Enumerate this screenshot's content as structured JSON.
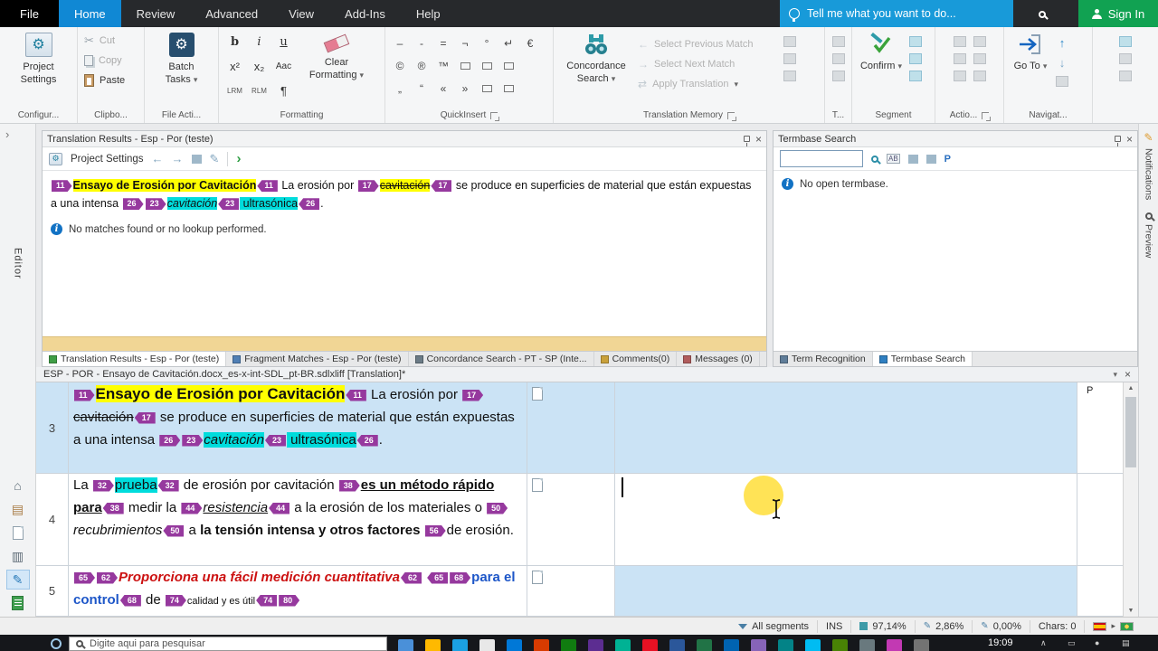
{
  "colors": {
    "hl_yellow": "#ffff00",
    "hl_cyan": "#00dcdc",
    "tag_purple": "#96399e",
    "row_active": "#cbe3f5",
    "accent_blue": "#189ad9",
    "signin_green": "#11a252",
    "red_text": "#cc1111",
    "blue_text": "#1d56c8"
  },
  "menubar": {
    "items": [
      {
        "label": "File",
        "style": "file"
      },
      {
        "label": "Home",
        "style": "active"
      },
      {
        "label": "Review",
        "style": ""
      },
      {
        "label": "Advanced",
        "style": ""
      },
      {
        "label": "View",
        "style": ""
      },
      {
        "label": "Add-Ins",
        "style": ""
      },
      {
        "label": "Help",
        "style": ""
      }
    ],
    "tellme": "Tell me what you want to do...",
    "signin": "Sign In"
  },
  "ribbon": {
    "project_settings": {
      "line1": "Project",
      "line2": "Settings",
      "group": "Configur..."
    },
    "clipboard": {
      "cut": "Cut",
      "copy": "Copy",
      "paste": "Paste",
      "group": "Clipbo..."
    },
    "file_actions": {
      "line1": "Batch",
      "line2": "Tasks",
      "group": "File Acti..."
    },
    "formatting": {
      "buttons": [
        "b",
        "i",
        "u",
        "x²",
        "x₂",
        "Aac",
        "LRM",
        "RLM",
        "¶"
      ],
      "clear_line1": "Clear",
      "clear_line2": "Formatting",
      "group": "Formatting"
    },
    "quickinsert": {
      "rows": [
        [
          "–",
          "‐",
          "=",
          "¬",
          "°",
          "↵",
          "€"
        ],
        [
          "©",
          "®",
          "™",
          "▭",
          "▭",
          "▭"
        ],
        [
          "„",
          "“",
          "«",
          "»",
          "▭",
          "▭"
        ]
      ],
      "group": "QuickInsert"
    },
    "tm": {
      "concordance_line1": "Concordance",
      "concordance_line2": "Search",
      "prev": "Select Previous Match",
      "next": "Select Next Match",
      "apply": "Apply Translation",
      "group": "Translation Memory"
    },
    "t_group": "T...",
    "segment": {
      "confirm": "Confirm",
      "group": "Segment"
    },
    "actions_group": "Actio...",
    "navigation": {
      "line1": "Go",
      "line2": "To",
      "group": "Navigat..."
    }
  },
  "results_panel": {
    "title": "Translation Results - Esp - Por (teste)",
    "project_settings_label": "Project Settings",
    "message": "No matches found or no lookup performed.",
    "runs": [
      {
        "tag": "11",
        "dir": "open"
      },
      {
        "text": "Ensayo de Erosión por Cavitación",
        "hl": "yellow",
        "bold": true
      },
      {
        "tag": "11",
        "dir": "close"
      },
      {
        "text": " La erosión por "
      },
      {
        "tag": "17",
        "dir": "open"
      },
      {
        "text": "cavitación",
        "hl": "yellow",
        "strike": true
      },
      {
        "tag": "17",
        "dir": "close"
      },
      {
        "text": " se produce en superficies de material que están expuestas a una intensa "
      },
      {
        "tag": "26",
        "dir": "open"
      },
      {
        "tag": "23",
        "dir": "open"
      },
      {
        "text": "cavitación",
        "hl": "cyan",
        "italic": true
      },
      {
        "tag": "23",
        "dir": "close"
      },
      {
        "text": " ultrasónica",
        "hl": "cyan"
      },
      {
        "tag": "26",
        "dir": "close"
      },
      {
        "text": "."
      }
    ],
    "tabs": [
      {
        "label": "Translation Results - Esp - Por (teste)",
        "active": true,
        "icon": "#3f9e46"
      },
      {
        "label": "Fragment Matches - Esp - Por (teste)",
        "active": false,
        "icon": "#4f7fb5"
      },
      {
        "label": "Concordance Search - PT - SP (Inte...",
        "active": false,
        "icon": "#6b7b86"
      },
      {
        "label": "Comments(0)",
        "active": false,
        "icon": "#c9a13b"
      },
      {
        "label": "Messages (0)",
        "active": false,
        "icon": "#b05c5c"
      }
    ]
  },
  "termbase_panel": {
    "title": "Termbase Search",
    "search_value": "",
    "message": "No open termbase.",
    "tabs": [
      {
        "label": "Term Recognition",
        "active": false,
        "icon": "#5f7d99"
      },
      {
        "label": "Termbase Search",
        "active": true,
        "icon": "#2f7fc1"
      }
    ]
  },
  "left_rail": {
    "view_label": "Editor"
  },
  "right_rail": {
    "tabs": [
      "Notifications",
      "Preview"
    ]
  },
  "editor": {
    "doc_tab": "ESP - POR - Ensayo de Cavitación.docx_es-x-int-SDL_pt-BR.sdlxliff [Translation]*",
    "segments": [
      {
        "number": "3",
        "state": "selected",
        "structure": "P",
        "source_runs": [
          {
            "tag": "11",
            "dir": "open"
          },
          {
            "text": "Ensayo de Erosión por Cavitación",
            "hl": "yellow",
            "bold": true,
            "size": "large"
          },
          {
            "tag": "11",
            "dir": "close"
          },
          {
            "text": " La erosión por "
          },
          {
            "tag": "17",
            "dir": "open"
          },
          {
            "text": "cavitación",
            "strike": true
          },
          {
            "tag": "17",
            "dir": "close"
          },
          {
            "text": " se produce en superficies de material que están expuestas a una intensa "
          },
          {
            "tag": "26",
            "dir": "open"
          },
          {
            "tag": "23",
            "dir": "open"
          },
          {
            "text": "cavitación",
            "hl": "cyan",
            "italic": true
          },
          {
            "tag": "23",
            "dir": "close"
          },
          {
            "text": " ultrasónica",
            "hl": "cyan"
          },
          {
            "tag": "26",
            "dir": "close"
          },
          {
            "text": "."
          }
        ]
      },
      {
        "number": "4",
        "state": "editing",
        "structure": "",
        "source_runs": [
          {
            "text": "La "
          },
          {
            "tag": "32",
            "dir": "open"
          },
          {
            "text": "prueba",
            "hl": "cyan"
          },
          {
            "tag": "32",
            "dir": "close"
          },
          {
            "text": " de erosión por cavitación "
          },
          {
            "tag": "38",
            "dir": "open"
          },
          {
            "text": "es un método rápido para",
            "bold": true,
            "underline": true
          },
          {
            "tag": "38",
            "dir": "close"
          },
          {
            "text": " medir la "
          },
          {
            "tag": "44",
            "dir": "open"
          },
          {
            "text": "resistencia",
            "italic": true,
            "underline": true
          },
          {
            "tag": "44",
            "dir": "close"
          },
          {
            "text": " a la erosión de los materiales o "
          },
          {
            "tag": "50",
            "dir": "open"
          },
          {
            "text": "recubrimientos",
            "italic": true
          },
          {
            "tag": "50",
            "dir": "close"
          },
          {
            "text": " a "
          },
          {
            "text": "la tensión intensa y otros factores ",
            "bold": true
          },
          {
            "tag": "56",
            "dir": "open"
          },
          {
            "text": "de erosión."
          }
        ]
      },
      {
        "number": "5",
        "state": "partial",
        "structure": "",
        "source_runs": [
          {
            "tag": "65",
            "dir": "open"
          },
          {
            "tag": "62",
            "dir": "open"
          },
          {
            "text": "Proporciona una fácil medición cuantitativa",
            "italic": true,
            "bold": true,
            "color": "red"
          },
          {
            "tag": "62",
            "dir": "close"
          },
          {
            "text": " "
          },
          {
            "tag": "65",
            "dir": "close"
          },
          {
            "tag": "68",
            "dir": "open"
          },
          {
            "text": "para el control",
            "bold": true,
            "color": "blue"
          },
          {
            "tag": "68",
            "dir": "close"
          },
          {
            "text": " de "
          },
          {
            "tag": "74",
            "dir": "open"
          },
          {
            "text": "calidad y es útil",
            "size": "small"
          },
          {
            "tag": "74",
            "dir": "close"
          },
          {
            "tag": "80",
            "dir": "open"
          }
        ]
      }
    ]
  },
  "statusbar": {
    "filter": "All segments",
    "mode": "INS",
    "pct_translated": "97,14%",
    "pct_draft": "2,86%",
    "pct_reviewed": "0,00%",
    "chars": "Chars: 0"
  },
  "taskbar": {
    "search_placeholder": "Digite aqui para pesquisar",
    "time": "19:09",
    "icons": [
      "#4a90d9",
      "#ffb900",
      "#1ba1e2",
      "#e8e8e8",
      "#0078d7",
      "#d83b01",
      "#107c10",
      "#5c2d91",
      "#00b294",
      "#e81123",
      "#2b579a",
      "#217346",
      "#0063b1",
      "#8764b8",
      "#038387",
      "#00bcf2",
      "#498205",
      "#69797e",
      "#c239b3",
      "#737373"
    ]
  }
}
